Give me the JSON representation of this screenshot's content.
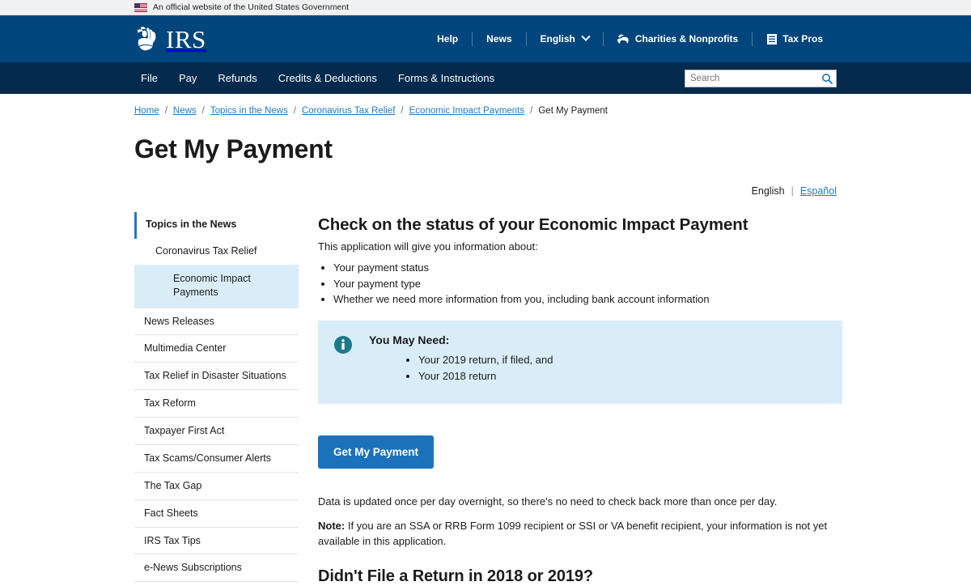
{
  "gov_banner": {
    "text": "An official website of the United States Government",
    "flag_icon": "us-flag-icon"
  },
  "header": {
    "logo_text": "IRS",
    "logo_icon": "irs-eagle-logo",
    "utility_nav": [
      {
        "label": "Help",
        "icon": null
      },
      {
        "label": "News",
        "icon": null
      },
      {
        "label": "English",
        "icon": "chevron-down-icon"
      },
      {
        "label": "Charities & Nonprofits",
        "icon": "charities-icon"
      },
      {
        "label": "Tax Pros",
        "icon": "tax-pros-book-icon"
      }
    ],
    "main_nav": [
      {
        "label": "File"
      },
      {
        "label": "Pay"
      },
      {
        "label": "Refunds"
      },
      {
        "label": "Credits & Deductions"
      },
      {
        "label": "Forms & Instructions"
      }
    ],
    "search": {
      "placeholder": "Search",
      "value": "",
      "icon": "search-icon"
    },
    "colors": {
      "top_bar": "#00457c",
      "nav_bar": "#042a4d"
    }
  },
  "breadcrumb": {
    "items": [
      {
        "label": "Home",
        "current": false
      },
      {
        "label": "News",
        "current": false
      },
      {
        "label": "Topics in the News",
        "current": false
      },
      {
        "label": "Coronavirus Tax Relief",
        "current": false
      },
      {
        "label": "Economic Impact Payments",
        "current": false
      },
      {
        "label": "Get My Payment",
        "current": true
      }
    ],
    "separator": "/"
  },
  "page": {
    "title": "Get My Payment"
  },
  "language_switch": {
    "active": "English",
    "separator": "|",
    "alternate": "Español"
  },
  "sidebar": {
    "items": [
      {
        "label": "Topics in the News",
        "level": 1,
        "active_parent": true
      },
      {
        "label": "Coronavirus Tax Relief",
        "level": 2,
        "active_parent": false
      },
      {
        "label": "Economic Impact Payments",
        "level": 3,
        "selected": true
      },
      {
        "label": "News Releases",
        "level": 0
      },
      {
        "label": "Multimedia Center",
        "level": 0
      },
      {
        "label": "Tax Relief in Disaster Situations",
        "level": 0
      },
      {
        "label": "Tax Reform",
        "level": 0
      },
      {
        "label": "Taxpayer First Act",
        "level": 0
      },
      {
        "label": "Tax Scams/Consumer Alerts",
        "level": 0
      },
      {
        "label": "The Tax Gap",
        "level": 0
      },
      {
        "label": "Fact Sheets",
        "level": 0
      },
      {
        "label": "IRS Tax Tips",
        "level": 0
      },
      {
        "label": "e-News Subscriptions",
        "level": 0
      }
    ],
    "highlight_color": "#d9edf8",
    "accent_color": "#2378c3"
  },
  "main": {
    "heading": "Check on the status of your Economic Impact Payment",
    "intro": "This application will give you information about:",
    "info_list": [
      "Your payment status",
      "Your payment type",
      "Whether we need more information from you, including bank account information"
    ],
    "callout": {
      "icon": "info-circle-icon",
      "icon_color": "#1a7a8c",
      "title": "You May Need:",
      "items": [
        "Your 2019 return, if filed, and",
        "Your 2018 return"
      ],
      "background": "#d9edf8"
    },
    "cta_button": {
      "label": "Get My Payment",
      "color": "#1b72ba"
    },
    "update_note": "Data is updated once per day overnight, so there's no need to check back more than once per day.",
    "note_label": "Note:",
    "note_text": " If you are an SSA or RRB Form 1099 recipient or SSI or VA benefit recipient, your information is not yet available in this application.",
    "bottom_heading": "Didn't File a Return in 2018 or 2019?"
  }
}
